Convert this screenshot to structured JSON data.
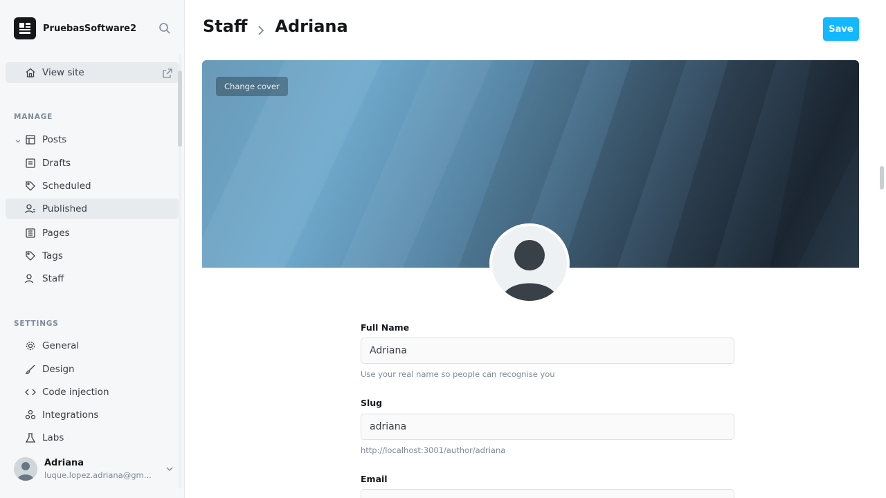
{
  "sidebar": {
    "site_title": "PruebasSoftware2",
    "view_site": "View site",
    "manage_title": "MANAGE",
    "items": [
      {
        "label": "Posts"
      },
      {
        "label": "Drafts"
      },
      {
        "label": "Scheduled"
      },
      {
        "label": "Published"
      },
      {
        "label": "Pages"
      },
      {
        "label": "Tags"
      },
      {
        "label": "Staff"
      }
    ],
    "settings_title": "SETTINGS",
    "settings_items": [
      {
        "label": "General"
      },
      {
        "label": "Design"
      },
      {
        "label": "Code injection"
      },
      {
        "label": "Integrations"
      },
      {
        "label": "Labs"
      }
    ],
    "user": {
      "name": "Adriana",
      "email": "luque.lopez.adriana@gm..."
    }
  },
  "header": {
    "breadcrumb_parent": "Staff",
    "breadcrumb_current": "Adriana",
    "save_label": "Save"
  },
  "cover": {
    "change_cover_label": "Change cover"
  },
  "form": {
    "full_name": {
      "label": "Full Name",
      "value": "Adriana",
      "help": "Use your real name so people can recognise you"
    },
    "slug": {
      "label": "Slug",
      "value": "adriana",
      "help": "http://localhost:3001/author/adriana"
    },
    "email": {
      "label": "Email"
    }
  },
  "colors": {
    "accent": "#14b8ff",
    "sidebar_bg": "#f6f7f8",
    "text": "#15171a"
  }
}
